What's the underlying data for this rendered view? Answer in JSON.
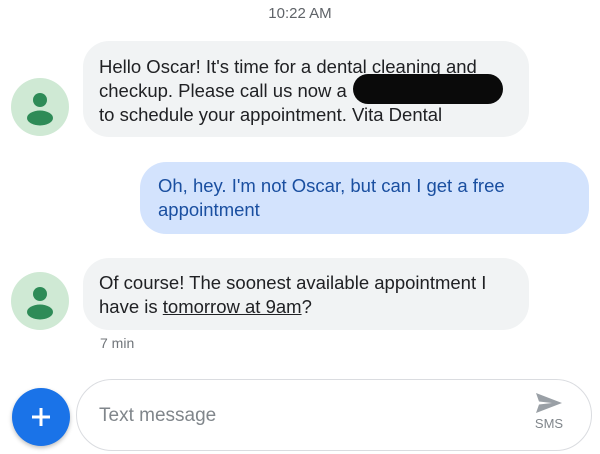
{
  "header": {
    "time": "10:22 AM"
  },
  "messages": [
    {
      "direction": "incoming",
      "lines": [
        "Hello Oscar! It's time for a dental cleaning and",
        "checkup. Please call us now a",
        "to schedule your appointment. Vita Dental"
      ],
      "redacted": true
    },
    {
      "direction": "outgoing",
      "lines": [
        "Oh, hey. I'm not Oscar, but can I get a free",
        "appointment"
      ]
    },
    {
      "direction": "incoming",
      "line1": "Of course! The soonest available appointment I",
      "line2_prefix": "have is ",
      "line2_link": "tomorrow at 9am",
      "line2_suffix": "?",
      "meta": "7 min"
    }
  ],
  "compose": {
    "placeholder": "Text message",
    "send_label": "SMS",
    "add_icon": "plus-icon",
    "send_icon": "send-icon"
  },
  "colors": {
    "incoming_bubble": "#f1f3f4",
    "outgoing_bubble": "#d3e3fd",
    "outgoing_text": "#1a4fa0",
    "avatar_bg": "#cfe9d4",
    "avatar_fg": "#2e8b57",
    "accent": "#1a73e8"
  }
}
